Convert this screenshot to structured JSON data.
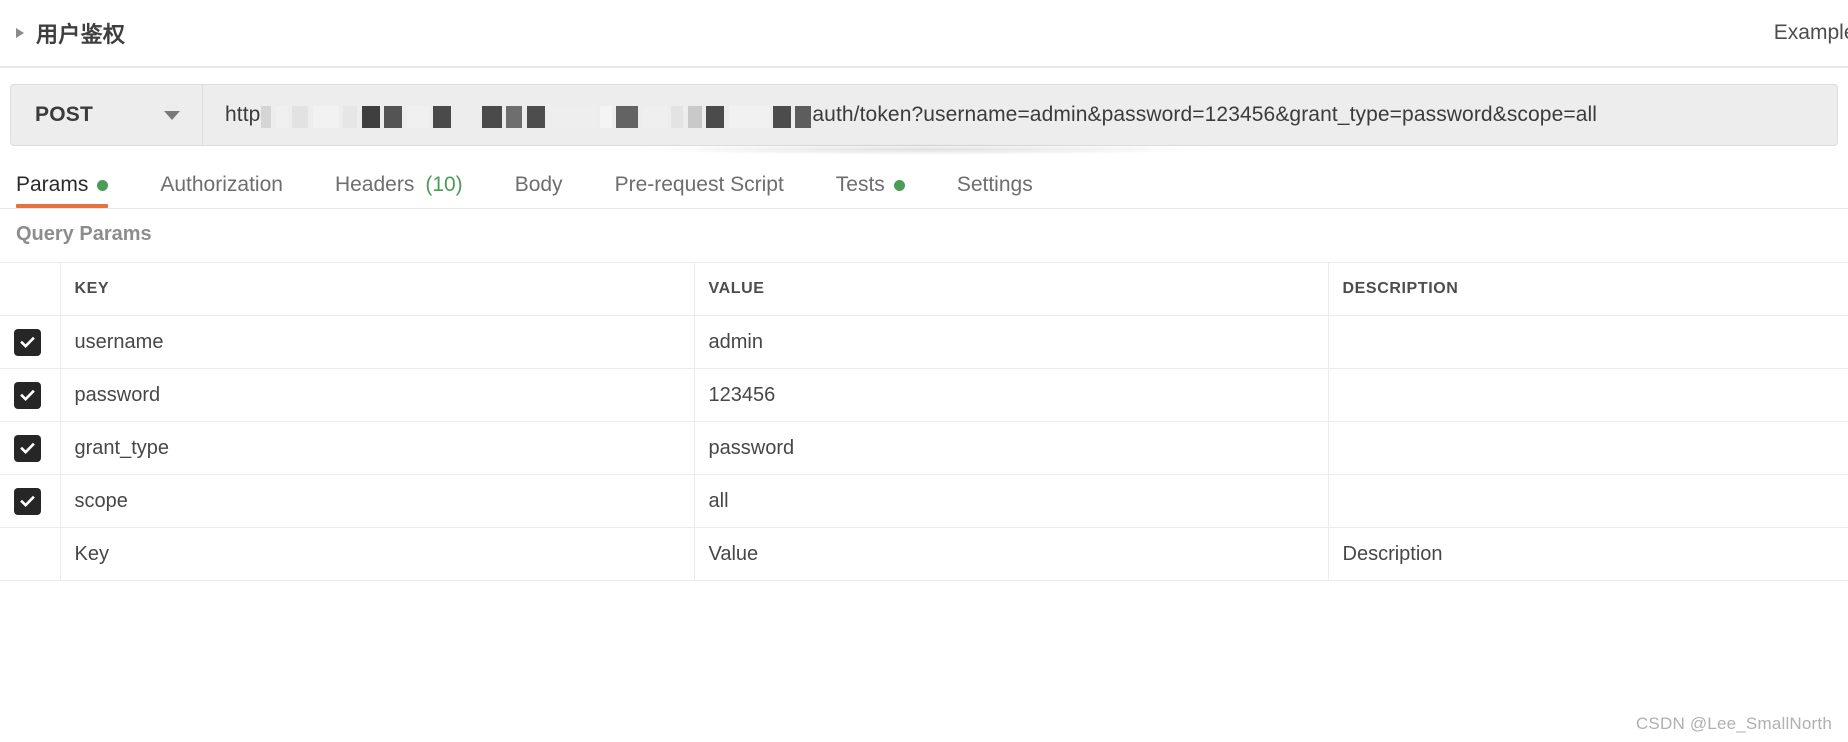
{
  "collection": {
    "title": "用户鉴权",
    "disclosure_icon": "triangle-right-icon",
    "right_action_label": "Examples"
  },
  "request": {
    "method": "POST",
    "method_caret_icon": "chevron-down-icon",
    "url_visible_prefix": "http",
    "url_redacted": true,
    "url_visible_suffix": "auth/token?username=admin&password=123456&grant_type=password&scope=all",
    "url_full": "http[redacted]auth/token?username=admin&password=123456&grant_type=password&scope=all"
  },
  "tabs": [
    {
      "label": "Params",
      "active": true,
      "dot": true,
      "count": ""
    },
    {
      "label": "Authorization",
      "active": false,
      "dot": false,
      "count": ""
    },
    {
      "label": "Headers",
      "active": false,
      "dot": false,
      "count": "(10)"
    },
    {
      "label": "Body",
      "active": false,
      "dot": false,
      "count": ""
    },
    {
      "label": "Pre-request Script",
      "active": false,
      "dot": false,
      "count": ""
    },
    {
      "label": "Tests",
      "active": false,
      "dot": true,
      "count": ""
    },
    {
      "label": "Settings",
      "active": false,
      "dot": false,
      "count": ""
    }
  ],
  "params_section": {
    "title": "Query Params",
    "columns": {
      "key": "KEY",
      "value": "VALUE",
      "description": "DESCRIPTION"
    },
    "rows": [
      {
        "checked": true,
        "key": "username",
        "value": "admin",
        "description": ""
      },
      {
        "checked": true,
        "key": "password",
        "value": "123456",
        "description": ""
      },
      {
        "checked": true,
        "key": "grant_type",
        "value": "password",
        "description": ""
      },
      {
        "checked": true,
        "key": "scope",
        "value": "all",
        "description": ""
      }
    ],
    "placeholder_row": {
      "key": "Key",
      "value": "Value",
      "description": "Description"
    }
  },
  "watermark": "CSDN @Lee_SmallNorth",
  "colors": {
    "accent_active_tab": "#e8713f",
    "status_green": "#4a9c57",
    "checkbox_fill": "#262626",
    "bar_background": "#ededed"
  }
}
